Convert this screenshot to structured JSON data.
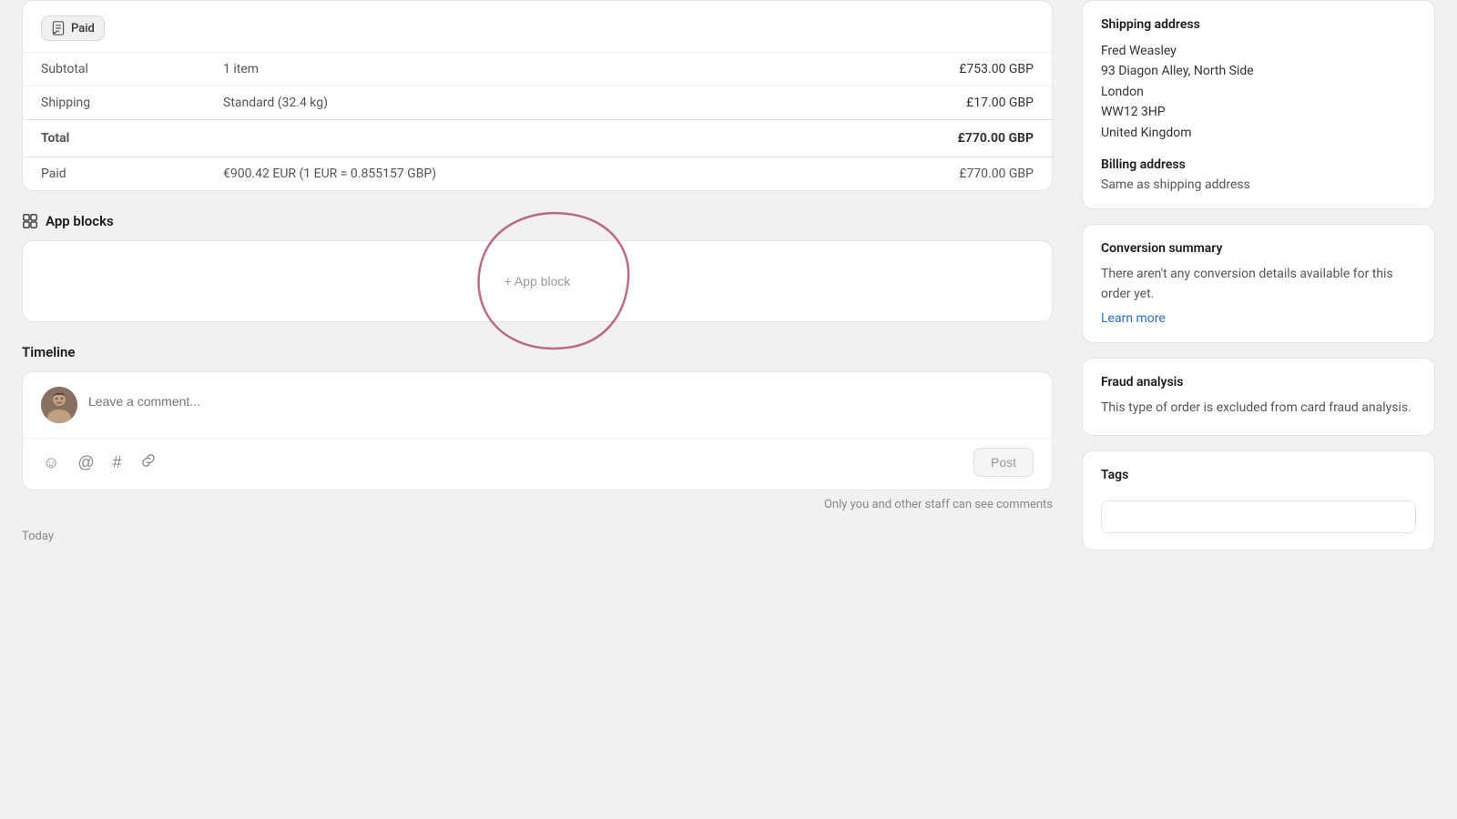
{
  "payment": {
    "paid_badge": "Paid",
    "subtotal_label": "Subtotal",
    "subtotal_qty": "1 item",
    "subtotal_amount": "£753.00 GBP",
    "shipping_label": "Shipping",
    "shipping_detail": "Standard (32.4 kg)",
    "shipping_amount": "£17.00 GBP",
    "total_label": "Total",
    "total_amount": "£770.00 GBP",
    "paid_label": "Paid",
    "paid_detail": "€900.42 EUR (1 EUR = 0.855157 GBP)",
    "paid_amount": "£770.00 GBP"
  },
  "app_blocks": {
    "section_title": "App blocks",
    "add_block_label": "+ App block"
  },
  "timeline": {
    "section_title": "Timeline",
    "comment_placeholder": "Leave a comment...",
    "post_button": "Post",
    "staff_note": "Only you and other staff can see comments",
    "today_label": "Today"
  },
  "shipping_address": {
    "title": "Shipping address",
    "name": "Fred Weasley",
    "street": "93 Diagon Alley, North Side",
    "city": "London",
    "postcode": "WW12 3HP",
    "country": "United Kingdom"
  },
  "billing_address": {
    "title": "Billing address",
    "value": "Same as shipping address"
  },
  "conversion_summary": {
    "title": "Conversion summary",
    "text": "There aren't any conversion details available for this order yet.",
    "learn_more": "Learn more"
  },
  "fraud_analysis": {
    "title": "Fraud analysis",
    "text": "This type of order is excluded from card fraud analysis."
  },
  "tags": {
    "title": "Tags",
    "placeholder": ""
  }
}
